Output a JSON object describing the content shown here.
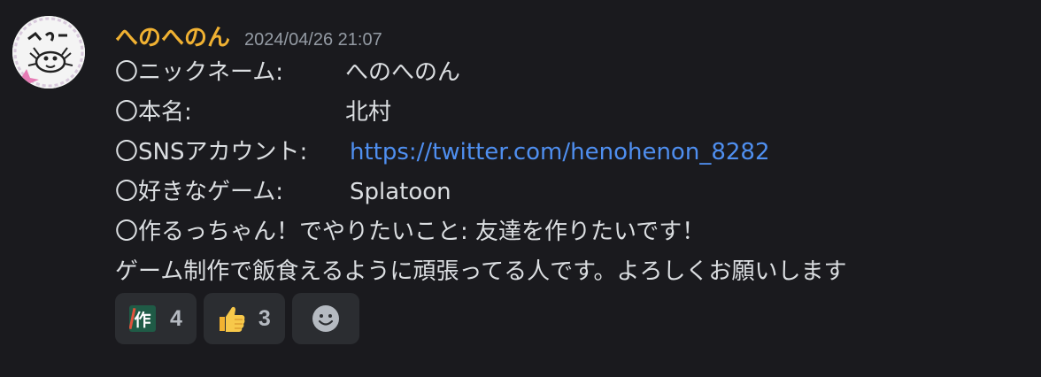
{
  "message": {
    "username": "へのへのん",
    "timestamp": "2024/04/26 21:07",
    "lines": [
      {
        "label": "〇ニックネーム:",
        "value": "へのへのん"
      },
      {
        "label": "〇本名:",
        "value": "北村"
      },
      {
        "label": "〇SNSアカウント:",
        "link": "https://twitter.com/henohenon_8282"
      },
      {
        "label": "〇好きなゲーム:",
        "value": "Splatoon"
      },
      {
        "label": "〇作るっちゃん！でやりたいこと:",
        "value": "友達を作りたいです！"
      },
      {
        "text": "ゲーム制作で飯食えるように頑張ってる人です。よろしくお願いします"
      }
    ]
  },
  "reactions": [
    {
      "emoji": "saku-custom-icon",
      "glyph": "作",
      "count": "4"
    },
    {
      "emoji": "thumbs-up-icon",
      "count": "3"
    },
    {
      "emoji": "add-reaction-smiley-icon"
    }
  ],
  "colors": {
    "background": "#1a1a1e",
    "username": "#f0b132",
    "timestamp": "#949ba4",
    "text": "#dbdee1",
    "link": "#4f8ff0",
    "reaction_bg": "#2b2d31"
  }
}
